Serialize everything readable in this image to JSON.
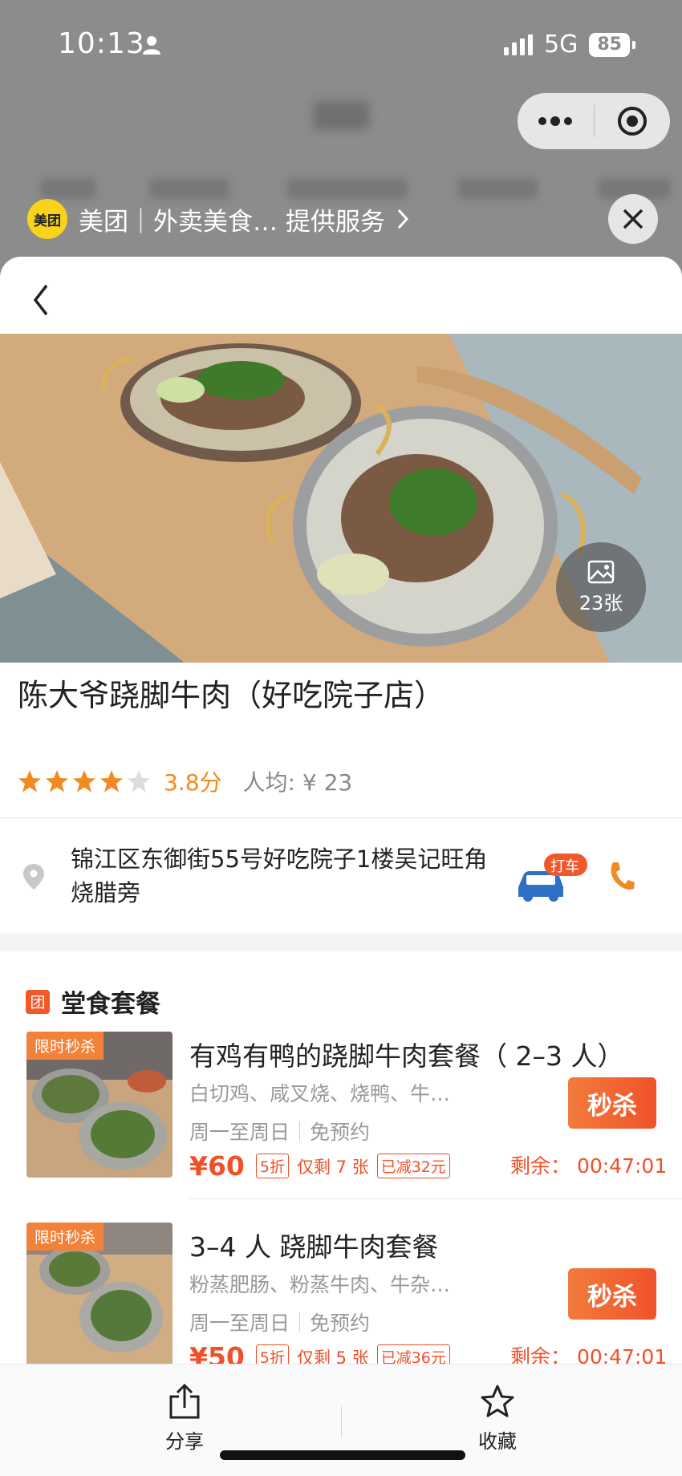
{
  "status_bar": {
    "time": "10:13",
    "network": "5G",
    "battery": "85"
  },
  "service_bar": {
    "logo_text": "美团",
    "text": "美团｜外卖美食…  提供服务"
  },
  "shop": {
    "name": "陈大爷跷脚牛肉（好吃院子店）",
    "rating_stars": 3.8,
    "score": "3.8分",
    "avg_price": "人均: ¥ 23",
    "photo_count": "23张",
    "address": "锦江区东御街55号好吃院子1楼吴记旺角烧腊旁",
    "taxi_label": "打车"
  },
  "section": {
    "icon_text": "团",
    "title": "堂食套餐"
  },
  "deals": [
    {
      "tag": "限时秒杀",
      "title": "有鸡有鸭的跷脚牛肉套餐（ 2–3 人）",
      "items": "白切鸡、咸叉烧、烧鸭、牛…",
      "days": "周一至周日",
      "booking": "免预约",
      "price": "¥60",
      "discount": "5折",
      "remaining": "仅剩 7 张",
      "saved": "已减32元",
      "button": "秒杀",
      "countdown": "剩余：  00:47:01"
    },
    {
      "tag": "限时秒杀",
      "title": "3–4 人 跷脚牛肉套餐",
      "items": "粉蒸肥肠、粉蒸牛肉、牛杂…",
      "days": "周一至周日",
      "booking": "免预约",
      "price": "¥50",
      "discount": "5折",
      "remaining": "仅剩 5 张",
      "saved": "已减36元",
      "button": "秒杀",
      "countdown": "剩余：  00:47:01"
    }
  ],
  "bottom_bar": {
    "share": "分享",
    "favorite": "收藏"
  },
  "colors": {
    "accent": "#f08a21",
    "deal_red": "#f0502a",
    "brand_yellow": "#f8d21b"
  }
}
